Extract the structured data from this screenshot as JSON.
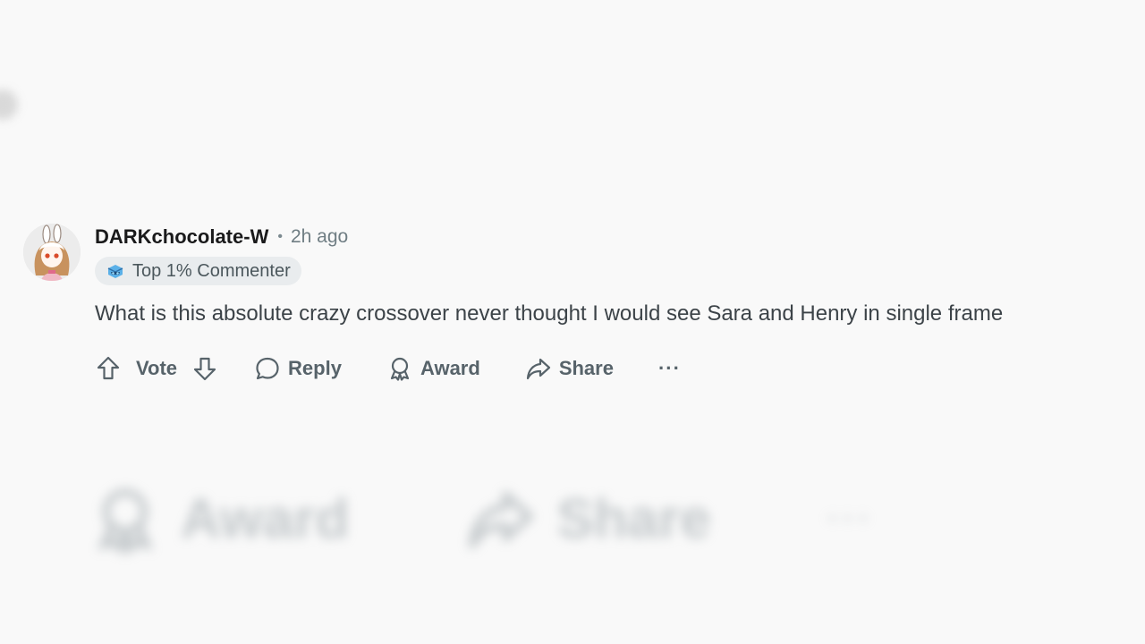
{
  "comment": {
    "username": "DARKchocolate-W",
    "separator": "•",
    "timestamp": "2h ago",
    "flair": {
      "label": "Top 1% Commenter",
      "icon": "commenter-badge-icon"
    },
    "text": "What is this absolute crazy crossover never thought I would see Sara and Henry in single frame",
    "avatar": {
      "icon": "bunny-girl-avatar"
    }
  },
  "actions": {
    "vote_label": "Vote",
    "reply_label": "Reply",
    "award_label": "Award",
    "share_label": "Share",
    "more_label": "···"
  },
  "ghost": {
    "award_label": "Award",
    "share_label": "Share",
    "more_label": "···"
  },
  "colors": {
    "background": "#f9f9f9",
    "action_gray": "#57636a",
    "flair_bg": "#e9ecee"
  }
}
